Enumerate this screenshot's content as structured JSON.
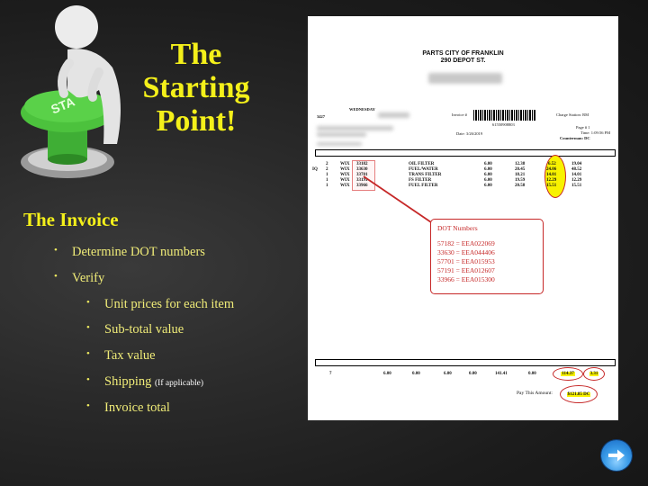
{
  "slide": {
    "headline_lines": [
      "The",
      "Starting",
      "Point!"
    ],
    "illustration": {
      "icon": "figure-pushing-start-button-icon",
      "button_text": "START",
      "button_color": "#3cb43c"
    },
    "section_title": "The Invoice",
    "bullets": [
      {
        "level": 1,
        "text": "Determine DOT numbers"
      },
      {
        "level": 1,
        "text": "Verify"
      },
      {
        "level": 2,
        "text": "Unit prices for each item"
      },
      {
        "level": 2,
        "text": "Sub-total value"
      },
      {
        "level": 2,
        "text": "Tax value"
      },
      {
        "level": 2,
        "text": "Shipping",
        "note": "(If applicable)"
      },
      {
        "level": 2,
        "text": "Invoice total"
      }
    ],
    "text_color": "#f4f01a"
  },
  "invoice": {
    "store_name": "PARTS CITY OF FRANKLIN",
    "store_address": "290 DEPOT ST.",
    "day": "WEDNESDAY",
    "left_code": "3427",
    "invoice_label": "Invoice #",
    "invoice_number": "61550908803",
    "date_label": "Date: 3/26/2019",
    "charge_station": "Charge Station: RM",
    "page": "Page # 1",
    "time": "Time: 1:09:56 PM",
    "counterman": "Counterman: DC",
    "line_items": [
      {
        "flag": "",
        "qty": "2",
        "line": "WIX",
        "part": "33182",
        "desc": "OIL FILTER",
        "a": "6.00",
        "list": "12.38",
        "price": "6.52",
        "ext": "19.04"
      },
      {
        "flag": "IQ",
        "qty": "2",
        "line": "WIX",
        "part": "33630",
        "desc": "FUEL/WATER",
        "a": "6.00",
        "list": "20.45",
        "price": "24.06",
        "ext": "48.52"
      },
      {
        "flag": "",
        "qty": "1",
        "line": "WIX",
        "part": "33701",
        "desc": "TRANS FILTER",
        "a": "6.00",
        "list": "18.21",
        "price": "14.01",
        "ext": "14.01"
      },
      {
        "flag": "",
        "qty": "1",
        "line": "WIX",
        "part": "33191",
        "desc": "FS FILTER",
        "a": "6.00",
        "list": "19.59",
        "price": "12.29",
        "ext": "12.29"
      },
      {
        "flag": "",
        "qty": "1",
        "line": "WIX",
        "part": "33966",
        "desc": "FUEL FILTER",
        "a": "6.00",
        "list": "20.58",
        "price": "15.51",
        "ext": "15.51"
      }
    ],
    "dot_box": {
      "title": "DOT Numbers",
      "rows": [
        "57182  =  EEA022069",
        "33630  =  EEA044406",
        "57701  =  EEA015953",
        "57191  =  EEA012607",
        "33966  =  EEA015300"
      ]
    },
    "totals": {
      "qty": "7",
      "v1": "6.00",
      "v2": "0.00",
      "v3": "6.00",
      "v4": "0.00",
      "subtotal_list": "141.41",
      "v6": "0.00",
      "taxable": "114.37",
      "tax": "3.31",
      "pay_label": "Pay This Amount:",
      "pay_amount": "$121.85 DC"
    }
  },
  "nav": {
    "next_icon": "arrow-right-icon"
  }
}
